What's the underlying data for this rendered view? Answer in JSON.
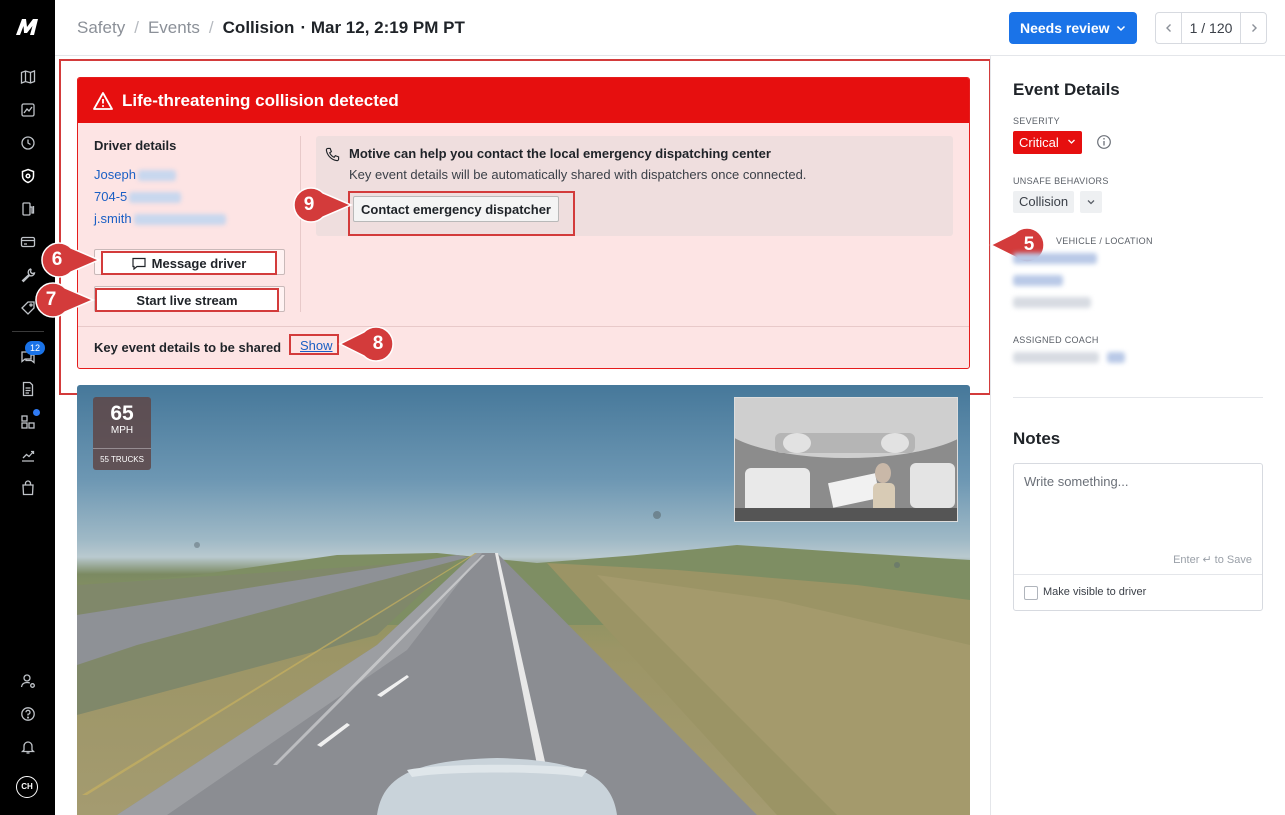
{
  "header": {
    "breadcrumb": [
      "Safety",
      "Events",
      "Collision"
    ],
    "timestamp": "Mar 12, 2:19 PM PT",
    "status_button": "Needs review",
    "pager": "1 / 120"
  },
  "leftnav": {
    "icons": [
      "map-icon",
      "dashboard-icon",
      "clock-icon",
      "shield-icon",
      "fuel-icon",
      "card-icon",
      "wrench-icon",
      "tag-icon",
      "messages-icon",
      "document-icon",
      "marketplace-icon",
      "analytics-icon",
      "bag-icon",
      "user-settings-icon",
      "help-icon",
      "bell-icon"
    ],
    "message_badge": "12",
    "avatar": "CH"
  },
  "alert": {
    "title": "Life-threatening collision detected",
    "driver_title": "Driver details",
    "driver_name": "Joseph",
    "driver_phone": "704-5",
    "driver_email": "j.smith",
    "message_button": "Message driver",
    "live_button": "Start live stream",
    "dispatch_title": "Motive can help you contact the local emergency dispatching center",
    "dispatch_sub": "Key event details will be automatically shared with dispatchers once connected.",
    "contact_button": "Contact emergency dispatcher",
    "key_details_label": "Key event details to be shared",
    "show_link": "Show"
  },
  "callouts": [
    "5",
    "6",
    "7",
    "8",
    "9"
  ],
  "video": {
    "speed": "65",
    "speed_unit": "MPH",
    "speed_limit": "55 TRUCKS"
  },
  "event_details": {
    "title": "Event Details",
    "severity_label": "SEVERITY",
    "severity_value": "Critical",
    "unsafe_label": "UNSAFE BEHAVIORS",
    "unsafe_value": "Collision",
    "vehicle_label": "VEHICLE / LOCATION",
    "coach_label": "ASSIGNED COACH"
  },
  "notes": {
    "title": "Notes",
    "placeholder": "Write something...",
    "save_hint": "Enter ↵ to Save",
    "visible_label": "Make visible to driver"
  },
  "colors": {
    "alert_red": "#e60f0f",
    "annotation_red": "#d33b3b",
    "primary_blue": "#1a73e8"
  }
}
